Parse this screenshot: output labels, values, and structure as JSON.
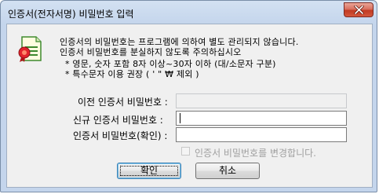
{
  "window": {
    "title": "인증서(전자서명) 비밀번호 입력",
    "close_icon": "close-icon"
  },
  "info": {
    "icon": "certificate-icon",
    "line1": "인증서의 비밀번호는 프로그램에 의하여 별도 관리되지 않습니다.",
    "line2": "인증서 비밀번호를 분실하지 않도록 주의하십시오",
    "line3": "* 영문, 숫자 포함 8자 이상~30자 이하 (대/소문자 구분)",
    "line4": "* 특수문자 이용 권장 ( ' \" ₩ 제외 )"
  },
  "form": {
    "old_password_label": "이전 인증서 비밀번호 :",
    "new_password_label": "신규 인증서 비밀번호 :",
    "confirm_password_label": "인증서 비밀번호(확인) :",
    "old_password_value": "",
    "new_password_value": "",
    "confirm_password_value": "",
    "change_password_checkbox_label": "인증서 비밀번호를 변경합니다."
  },
  "buttons": {
    "ok_label": "확인",
    "cancel_label": "취소"
  },
  "colors": {
    "close_button": "#c13b22",
    "frame": "#c4d5ec",
    "default_button_border": "#3c7fb1"
  }
}
